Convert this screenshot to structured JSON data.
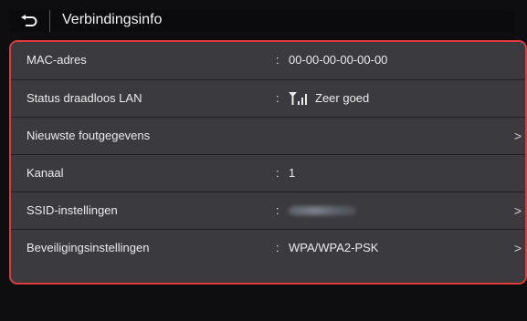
{
  "header": {
    "title": "Verbindingsinfo",
    "back_icon": "back-arrow-icon"
  },
  "rows": [
    {
      "label": "MAC-adres",
      "colon": ":",
      "value": "00-00-00-00-00-00",
      "chevron": ""
    },
    {
      "label": "Status draadloos LAN",
      "colon": ":",
      "value": "Zeer goed",
      "signal_icon": "wifi-signal-icon",
      "chevron": ""
    },
    {
      "label": "Nieuwste foutgegevens",
      "colon": "",
      "value": "",
      "chevron": ">"
    },
    {
      "label": "Kanaal",
      "colon": ":",
      "value": "1",
      "chevron": ""
    },
    {
      "label": "SSID-instellingen",
      "colon": ":",
      "value": "",
      "value_obscured": true,
      "chevron": ">"
    },
    {
      "label": "Beveiligingsinstellingen",
      "colon": ":",
      "value": "WPA/WPA2-PSK",
      "chevron": ">"
    }
  ],
  "colors": {
    "highlight_border": "#e03a3e",
    "row_bg": "#3b3b3f",
    "background": "#0e0e10"
  }
}
